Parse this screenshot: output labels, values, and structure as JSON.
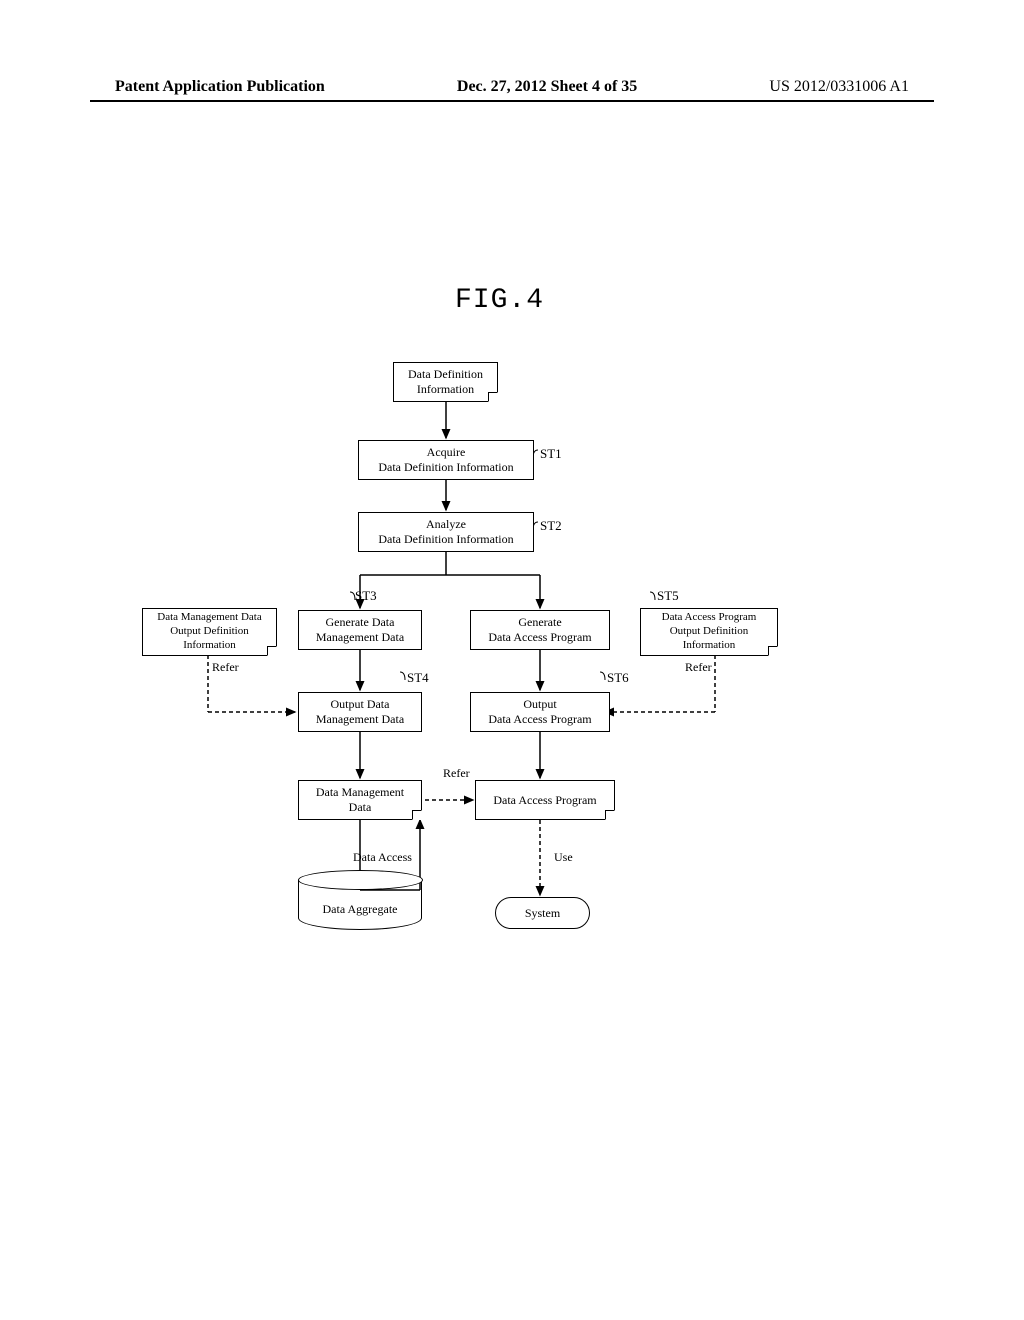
{
  "header": {
    "left": "Patent Application Publication",
    "mid": "Dec. 27, 2012  Sheet 4 of 35",
    "right": "US 2012/0331006 A1"
  },
  "figure": {
    "title": "FIG.4",
    "nodes": {
      "data_def_info": "Data Definition\nInformation",
      "acquire": "Acquire\nData Definition Information",
      "analyze": "Analyze\nData Definition Information",
      "gen_mgmt": "Generate Data\nManagement Data",
      "gen_access": "Generate\nData Access Program",
      "out_mgmt": "Output Data\nManagement Data",
      "out_access": "Output\nData Access Program",
      "mgmt_out_def": "Data Management Data\nOutput Definition\nInformation",
      "access_out_def": "Data Access Program\nOutput Definition\nInformation",
      "mgmt_data": "Data Management\nData",
      "access_prog": "Data Access Program",
      "aggregate": "Data Aggregate",
      "system": "System"
    },
    "step_refs": {
      "st1": "ST1",
      "st2": "ST2",
      "st3": "ST3",
      "st4": "ST4",
      "st5": "ST5",
      "st6": "ST6"
    },
    "edge_labels": {
      "refer_left": "Refer",
      "refer_right": "Refer",
      "refer_mid": "Refer",
      "use": "Use",
      "data_access": "Data Access"
    }
  }
}
